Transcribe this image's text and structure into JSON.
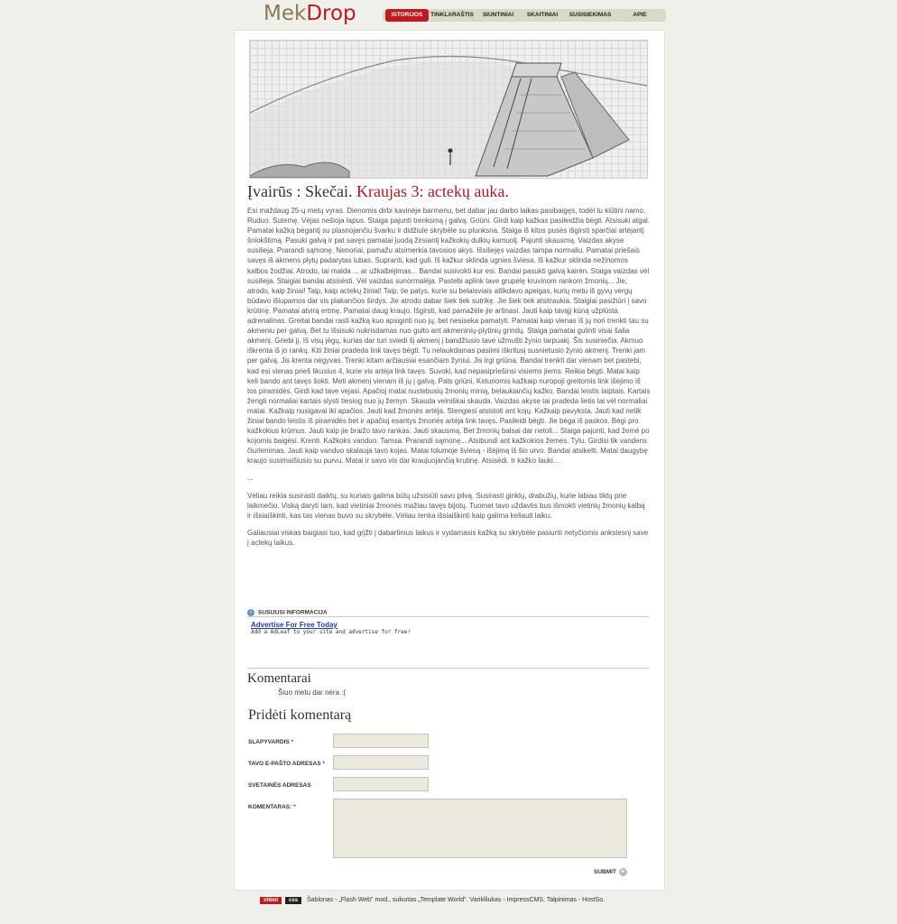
{
  "header": {
    "logo_part1": "Mek",
    "logo_part2": "Drop",
    "nav": [
      "ISTORIJOS",
      "TINKLARAŠTIS",
      "SIUNTINIAI",
      "SKAITINIAI",
      "SUSISIEKIMAS",
      "APIE"
    ],
    "active_nav": "ISTORIJOS"
  },
  "article": {
    "category": "Įvairūs : Skečai.",
    "title": "Kraujas 3: actekų auka.",
    "paragraphs": [
      "Esi maždaug 25-ų metų vyras. Dienomis dirbi kavinėje barmenu, bet dabar jau darbo laikas pasibaigęs, todėl tu kiūtini namo. Ruduo. Sutemę. Vėjas nešioja lapus. Staiga pajunti trenksmą į galvą. Griūni. Girdi kaip kažkas pasileidžia bėgti. Atsisuki atgal. Pamatai kažką bėgantį su plasnojančiu švarku ir didžiule skrybėle su plunksna. Staiga iš kitos pusės išgirsti sparčiai artėjantį šniokštimą. Pasuki galvą ir pat savęs pamatai juodą žirsiantį kažkokių dulkių kamuolį. Pajunti skausmą. Vaizdas akyse susilieja. Prarandi sąmonę. Nenoriai, pamažu atsimerkia tavosios akys. Išsiliejęs vaizdas tampa normaliu. Pamatai priešais savęs iš akmens plytų padarytas lubas. Supranti, kad guli. Iš kažkur sklinda ugnies šviesa. Iš kažkur sklinda nežinomos kalbos žodžiai. Atrodo, tai malda ... ar užkalbėjimas... Bandai susivokti kur esi. Bandai pasukti galvą kairėn. Staiga vaizdas vėl susilieja. Staigiai bandai atsisėsti. Vėl vaizdas sunormalėja. Pastebi aplink tave grupelę kruvinom rankom žmonių... Jie, atrodo, kaip žiniai! Taip, kaip actekų žiniai! Taip, tie patys, kurie su belaisviais atlikdavo apeigas, kurių metu iš gyvų vergų būdavo išlupamos dar vis plakančios širdys. Jie atrodo dabar šiek tiek sutrikę. Jie šiek tiek atsitraukia. Staigiai pasižiūri į savo krūtinę. Pamatai atvirą ertmę. Pamatai daug kraujo. Išgirsti, kad pamažėle jie artinasi. Jauti kaip tavąjį kūną užplūsta adrenalinas. Greitai bandai rasti kažką kuo apsiginti nuo jų, bet nesiseka pamatyti. Pamatai kaip vienas iš jų nori trenkti tau su akmeniu per galvą. Bet tu išsisuki nukrisdamas nuo gulto ant akmeninių-plytinių grindų. Staiga pamatai gulinti visai šalia akmenį. Griebi jį. Iš visų jėgų, kurias dar turi sviedi šį akmenį į bandžiusio tave užmušti žynio tarpuakį. Šis susiniečia. Akmuo iškrenta iš jo rankų. Kiti žiniai pradeda link tavęs bėgti. Tu nelaukdamas pasiimi iškritusį susnietusio žynio akmenį. Trenki jam per galvą. Jis krenta negyvas. Trenki kitam arčiausiai esančiam žyniui. Jis irgi griūna. Bandai trenkti dar vienam bet pastebi, kad esi vienas prieš likusius 4, kurie vis artėja link tavęs. Suvoki, kad nepasipriešinsi visiems jiems. Reikia bėgti. Matai kaip keli bando ant tavęs šokti. Meti akmenį vienam iš jų į galvą. Pats griūni. Keturiomis kažkaip nuropoji greitomis link išėjimo iš tos piramidės. Girdi kad tave vejasi. Apačioj matai nustebusių žmonių minią, belaukiančių kažko. Bandai leistis laiptais. Kartais žengti normaliai kartais slysti tiesiog nuo jų žemyn. Skauda velniškai skauda. Vaizdas akyse tai pradeda lietis tai vėl normaliai matai. Kažkaip nusigavai iki apačios. Jauti kad žmonės artėja. Stengiesi atsistoti ant kojų. Kažkaip pavyksta. Jauti kad netik žiniai bando leistis iš piramidės bet ir apačioj esantys žmonės artėja link tavęs. Pasileidi bėgti. Jie bėga iš paskos. Bėgi pro kažkokius krūmus. Jauti kaip jie braižo tavo rankas. Jauti skausmą. Bet žmonių balsai dar netoli... Staiga pajunti, kad žemė po kojomis baigėsi. Krenti. Kažkoks vanduo. Tamsa. Prarandi sąmonę... Atsibundi ant kažkokios žemės. Tylu. Girdisi tik vandens čiurlenimas. Jauti kaip vanduo skalauja tavo kojas. Matai tolumoje šviesą - išėjimą iš šio urvo. Bandai atsikelti. Matai daugybę kraujo susimaišiusio su purvu. Matai ir savo vis dar kraujuojančią krutinę. Atsisėdi. Ir kažko lauki...",
      "...",
      "Vėliau reikia susirasti daiktų, su kuriais galima būtų užsisiūti savo pilvą. Susirasti ginklų, drabužių, kurie labiau tiktų prie laikmečio. Viską daryti tam, kad vietiniai žmonės mažiau tavęs bijotų. Tuomet tavo uždavtis bus išmokti vietinių žmonių kalbą ir išsiaiškinti, kas tas vienas buvo su skrybėle. Vėliau tenka išsiaiškinti kaip galima keliauti laiku.",
      "Galiausiai viskas baigiasi tuo, kad grįžti į dabartinius laikus ir vydamasis kažką su skrybėle pasiunti netyčiomis ankstesnį save į actekų laikus."
    ]
  },
  "related": {
    "label": "SUSIJUSI INFORMACIJA",
    "ad_link": "Advertise For Free Today",
    "ad_sub": "Add a AdLeaf to your site and advertise for free!"
  },
  "comments": {
    "heading": "Komentarai",
    "empty": "Šiuo metu dar nėra :(",
    "form_heading": "Pridėti komentarą",
    "field_nick": "SLAPYVARDIS",
    "field_email": "TAVO E-PAŠTO ADRESAS",
    "field_site": "SVETAINĖS ADRESAS",
    "field_comment": "KOMENTARAS:",
    "required_mark": "*",
    "submit": "SUBMIT"
  },
  "footer": {
    "badge_xhtml": "xhtml",
    "badge_css": "css",
    "text": "Šablonas - „Flash Web\" mod., sukurtas „Template World\". Variklliukas - ImpressCMS. Talpinimas - HostSo."
  },
  "colors": {
    "accent": "#c0191f",
    "logo_brown": "#8a7a55",
    "input_bg": "#ebe8de",
    "page_bg": "#f0f0ea"
  }
}
